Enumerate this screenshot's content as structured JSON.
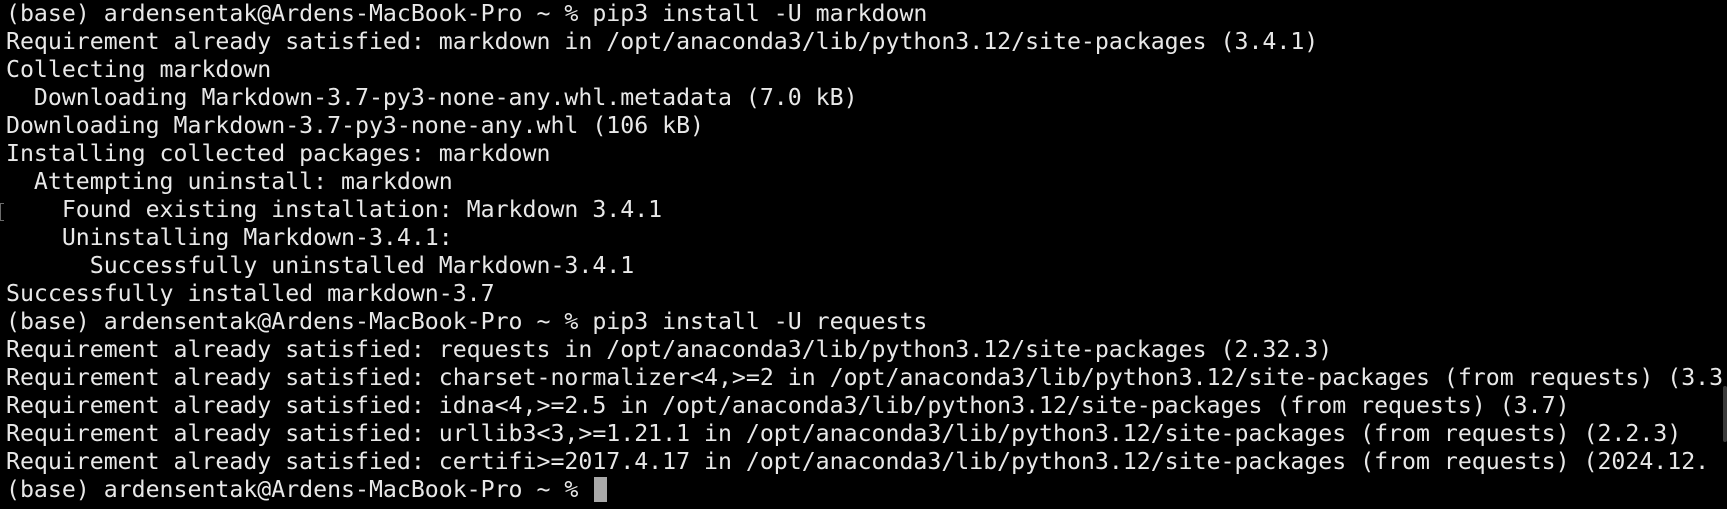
{
  "terminal": {
    "lines": [
      "(base) ardensentak@Ardens-MacBook-Pro ~ % pip3 install -U markdown",
      "Requirement already satisfied: markdown in /opt/anaconda3/lib/python3.12/site-packages (3.4.1)",
      "Collecting markdown",
      "  Downloading Markdown-3.7-py3-none-any.whl.metadata (7.0 kB)",
      "Downloading Markdown-3.7-py3-none-any.whl (106 kB)",
      "Installing collected packages: markdown",
      "  Attempting uninstall: markdown",
      "    Found existing installation: Markdown 3.4.1",
      "    Uninstalling Markdown-3.4.1:",
      "      Successfully uninstalled Markdown-3.4.1",
      "Successfully installed markdown-3.7",
      "(base) ardensentak@Ardens-MacBook-Pro ~ % pip3 install -U requests",
      "Requirement already satisfied: requests in /opt/anaconda3/lib/python3.12/site-packages (2.32.3)",
      "Requirement already satisfied: charset-normalizer<4,>=2 in /opt/anaconda3/lib/python3.12/site-packages (from requests) (3.3",
      "Requirement already satisfied: idna<4,>=2.5 in /opt/anaconda3/lib/python3.12/site-packages (from requests) (3.7)",
      "Requirement already satisfied: urllib3<3,>=1.21.1 in /opt/anaconda3/lib/python3.12/site-packages (from requests) (2.2.3)",
      "Requirement already satisfied: certifi>=2017.4.17 in /opt/anaconda3/lib/python3.12/site-packages (from requests) (2024.12.",
      "(base) ardensentak@Ardens-MacBook-Pro ~ % "
    ],
    "colors": {
      "background": "#000000",
      "text": "#e8e8e8",
      "cursor": "#a9a9a9"
    }
  }
}
